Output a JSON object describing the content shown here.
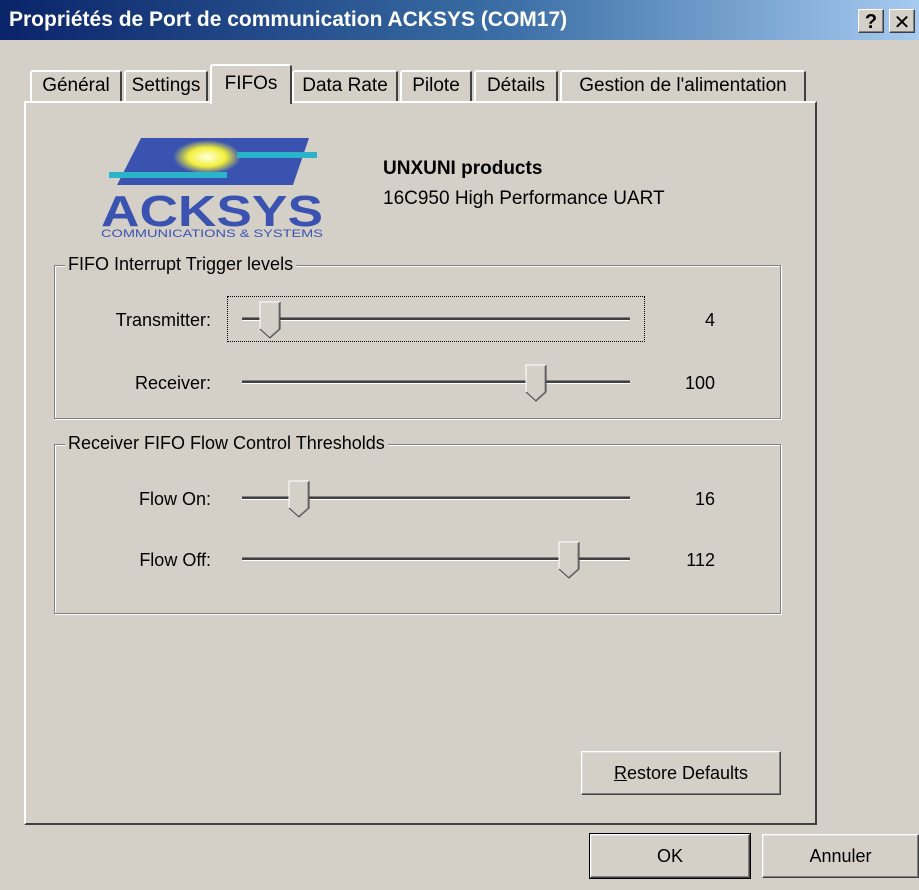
{
  "window": {
    "title": "Propriétés de Port de communication ACKSYS (COM17)",
    "help_glyph": "?",
    "close_glyph": "✕"
  },
  "tabs": [
    {
      "label": "Général",
      "active": false
    },
    {
      "label": "Settings",
      "active": false
    },
    {
      "label": "FIFOs",
      "active": true
    },
    {
      "label": "Data Rate",
      "active": false
    },
    {
      "label": "Pilote",
      "active": false
    },
    {
      "label": "Détails",
      "active": false
    },
    {
      "label": "Gestion de l'alimentation",
      "active": false
    }
  ],
  "logo": {
    "brand": "ACKSYS",
    "tagline": "COMMUNICATIONS & SYSTEMS",
    "colors": {
      "blue": "#3a53b0",
      "cyan": "#2bb3c9",
      "yellow": "#f2f03a"
    }
  },
  "product": {
    "title": "UNXUNI products",
    "subtitle": "16C950 High Performance UART"
  },
  "fifo_trigger": {
    "group_label": "FIFO Interrupt Trigger levels",
    "transmitter": {
      "label": "Transmitter:",
      "value": "4",
      "position": 0.05
    },
    "receiver": {
      "label": "Receiver:",
      "value": "100",
      "position": 0.77
    }
  },
  "flow_control": {
    "group_label": "Receiver FIFO Flow Control Thresholds",
    "flow_on": {
      "label": "Flow On:",
      "value": "16",
      "position": 0.13
    },
    "flow_off": {
      "label": "Flow Off:",
      "value": "112",
      "position": 0.86
    }
  },
  "buttons": {
    "restore_mnemonic": "R",
    "restore_rest": "estore Defaults",
    "ok": "OK",
    "cancel": "Annuler"
  }
}
